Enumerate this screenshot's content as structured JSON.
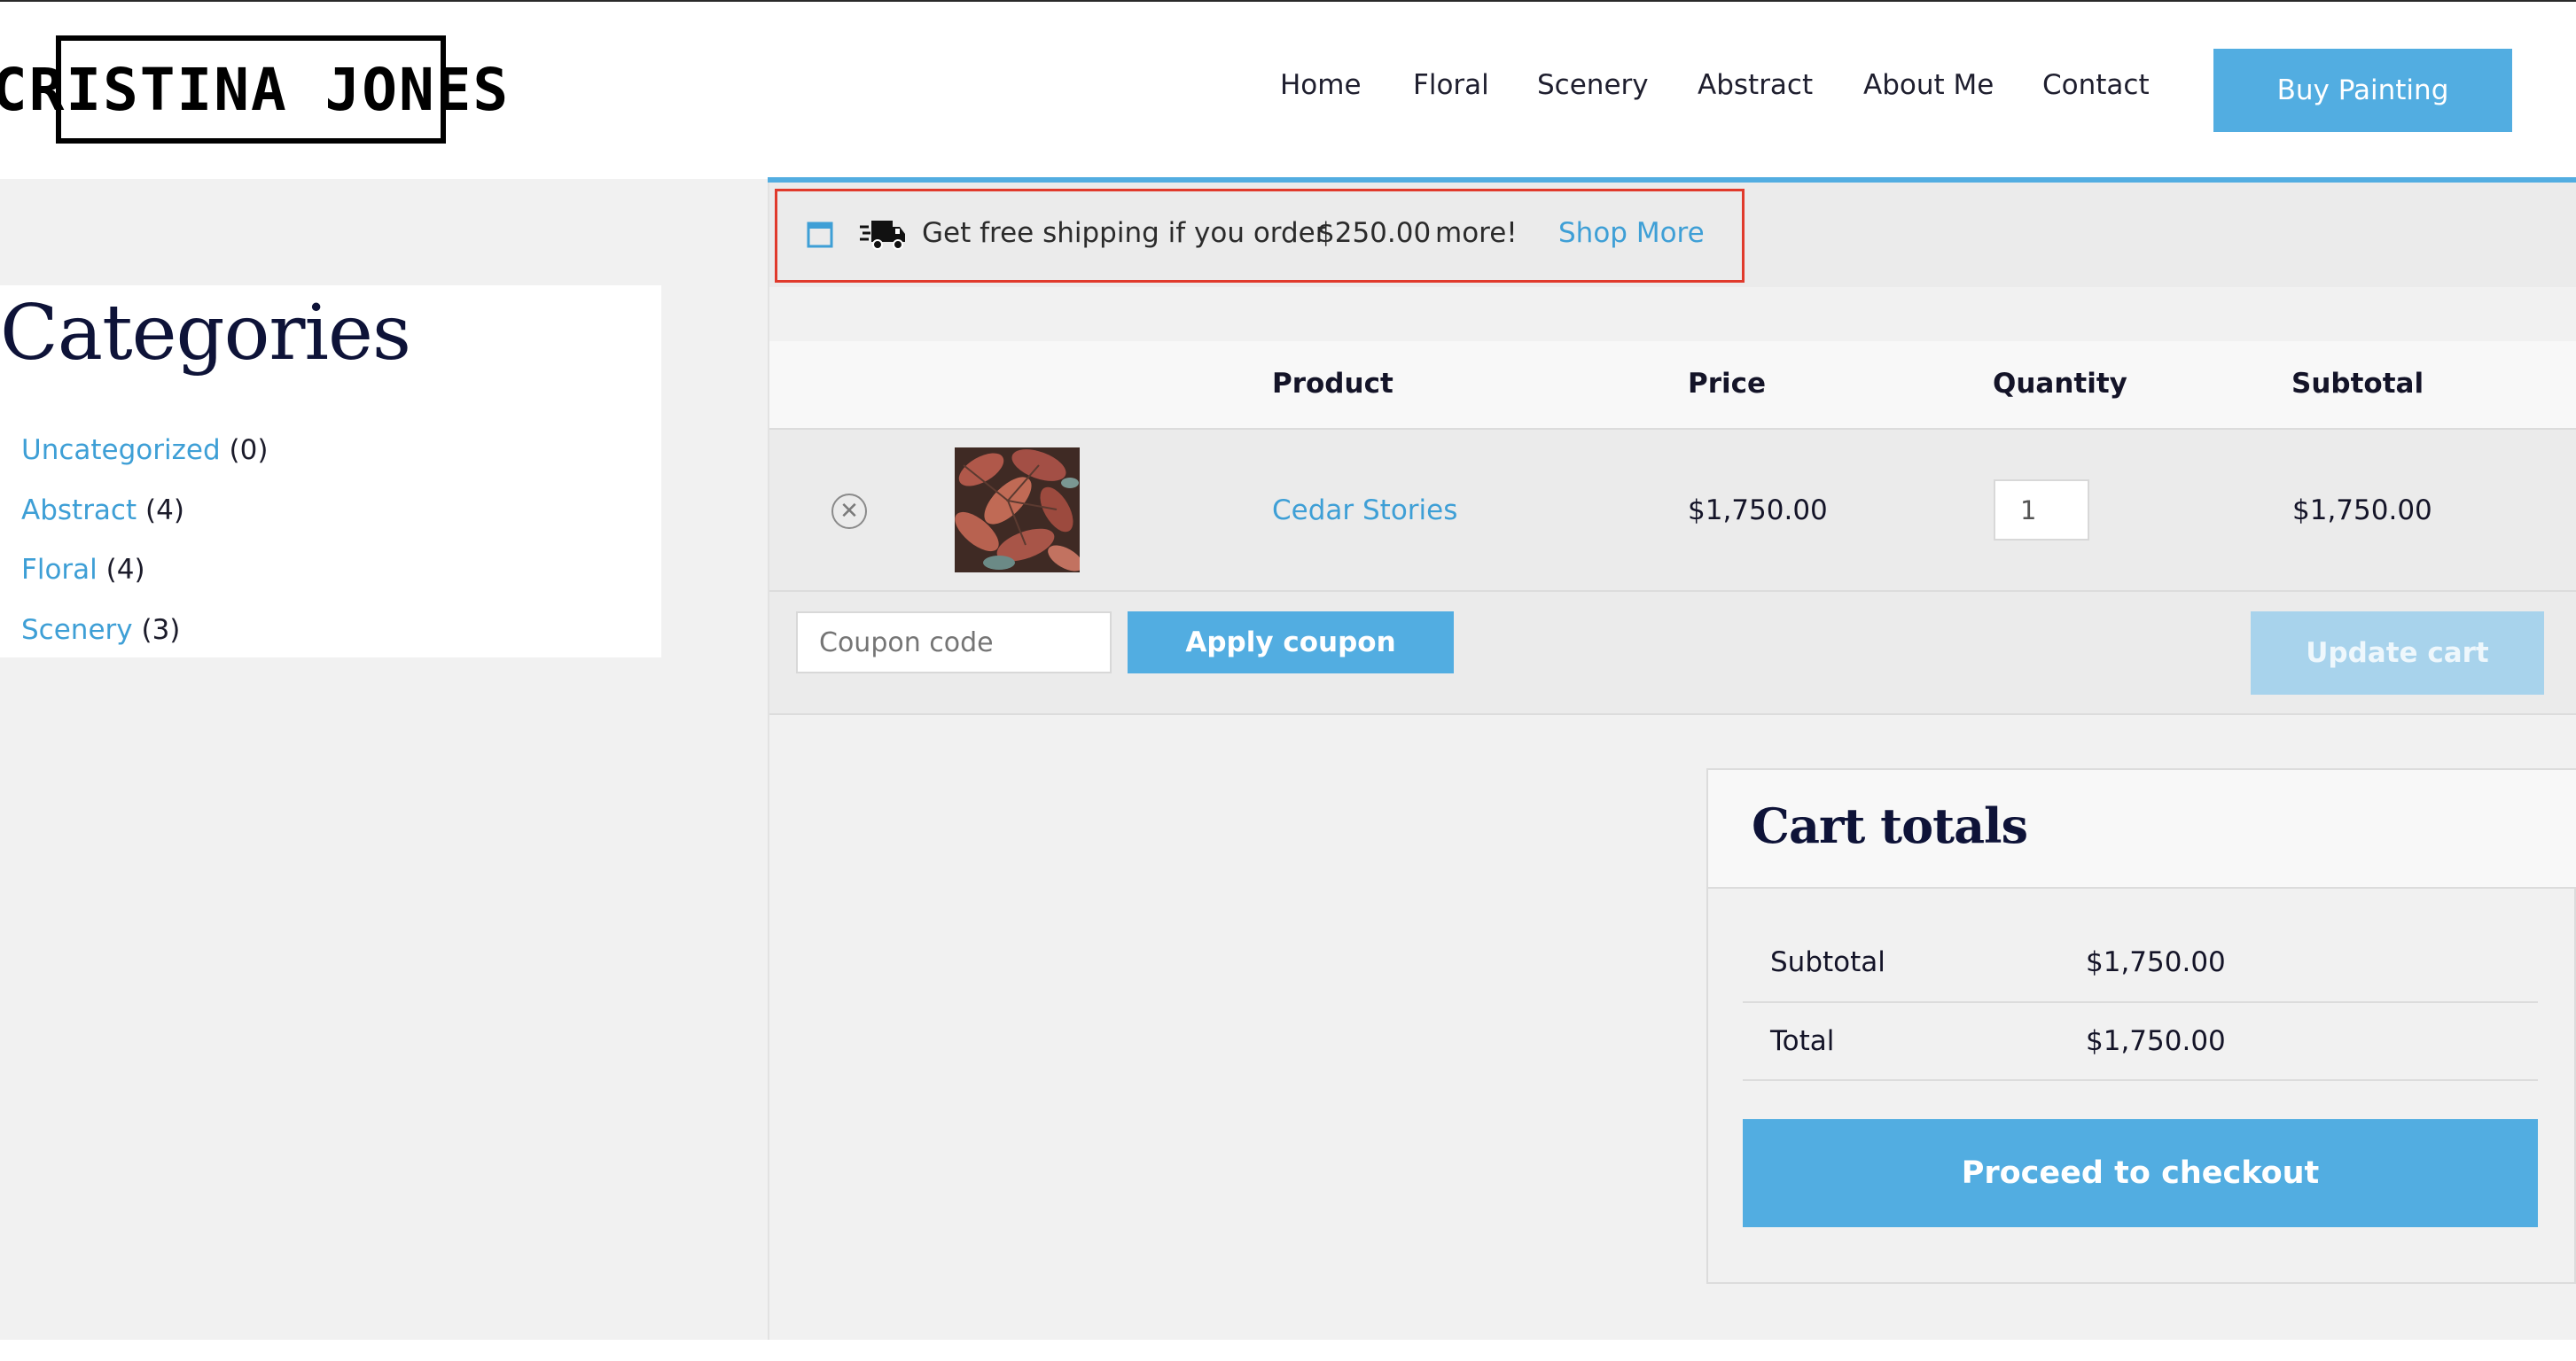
{
  "site": {
    "logo_text": "CRISTINA JONES"
  },
  "nav": {
    "items": [
      "Home",
      "Floral",
      "Scenery",
      "Abstract",
      "About Me",
      "Contact"
    ],
    "cta_label": "Buy Painting"
  },
  "sidebar": {
    "title": "Categories",
    "categories": [
      {
        "name": "Uncategorized",
        "count": "(0)"
      },
      {
        "name": "Abstract",
        "count": "(4)"
      },
      {
        "name": "Floral",
        "count": "(4)"
      },
      {
        "name": "Scenery",
        "count": "(3)"
      }
    ]
  },
  "notice": {
    "text_before": "Get free shipping if you order",
    "amount": "$250.00",
    "text_after": "more!",
    "link_label": "Shop More",
    "icons": [
      "window-icon",
      "delivery-truck-icon"
    ]
  },
  "cart": {
    "headers": {
      "product": "Product",
      "price": "Price",
      "quantity": "Quantity",
      "subtotal": "Subtotal"
    },
    "items": [
      {
        "name": "Cedar Stories",
        "price": "$1,750.00",
        "quantity": "1",
        "subtotal": "$1,750.00"
      }
    ],
    "coupon_placeholder": "Coupon code",
    "apply_coupon_label": "Apply coupon",
    "update_cart_label": "Update cart"
  },
  "totals": {
    "title": "Cart totals",
    "subtotal_label": "Subtotal",
    "subtotal_value": "$1,750.00",
    "total_label": "Total",
    "total_value": "$1,750.00",
    "checkout_label": "Proceed to checkout"
  },
  "colors": {
    "accent": "#52ade1",
    "link": "#3e9fd6",
    "heading": "#0e1338",
    "highlight_border": "#e03a2c",
    "page_bg": "#f1f1f1"
  }
}
